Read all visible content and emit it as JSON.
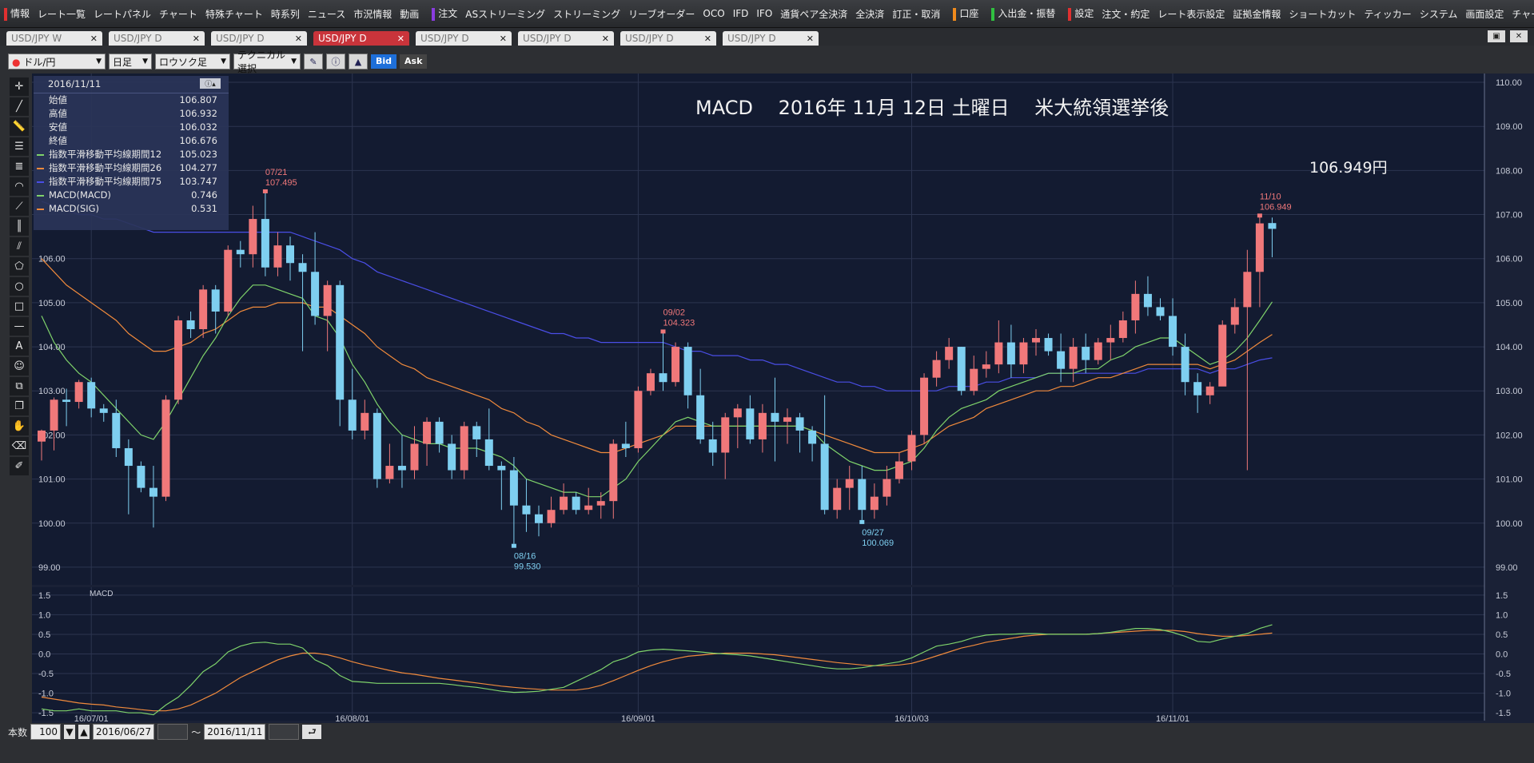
{
  "menubar": [
    "情報",
    "レート一覧",
    "レートパネル",
    "チャート",
    "特殊チャート",
    "時系列",
    "ニュース",
    "市況情報",
    "動画",
    "注文",
    "ASストリーミング",
    "ストリーミング",
    "リーブオーダー",
    "OCO",
    "IFD",
    "IFO",
    "通貨ペア全決済",
    "全決済",
    "訂正・取消",
    "口座",
    "入出金・振替",
    "設定",
    "注文・約定",
    "レート表示設定",
    "証拠金情報",
    "ショートカット",
    "ティッカー",
    "システム",
    "画面設定",
    "チャート"
  ],
  "tabs": [
    {
      "label": "USD/JPY W",
      "active": false
    },
    {
      "label": "USD/JPY D",
      "active": false
    },
    {
      "label": "USD/JPY D",
      "active": false
    },
    {
      "label": "USD/JPY D",
      "active": true
    },
    {
      "label": "USD/JPY D",
      "active": false
    },
    {
      "label": "USD/JPY D",
      "active": false
    },
    {
      "label": "USD/JPY D",
      "active": false
    },
    {
      "label": "USD/JPY D",
      "active": false
    }
  ],
  "toolbar": {
    "pair": "ドル/円",
    "period": "日足",
    "chart_type": "ロウソク足",
    "tech": "テクニカル選択",
    "bid": "Bid",
    "ask": "Ask"
  },
  "info": {
    "date": "2016/11/11",
    "rows": [
      {
        "label": "始値",
        "value": "106.807",
        "color": ""
      },
      {
        "label": "高値",
        "value": "106.932",
        "color": ""
      },
      {
        "label": "安値",
        "value": "106.032",
        "color": ""
      },
      {
        "label": "終値",
        "value": "106.676",
        "color": ""
      },
      {
        "label": "指数平滑移動平均線期間12",
        "value": "105.023",
        "color": "#7fd36b"
      },
      {
        "label": "指数平滑移動平均線期間26",
        "value": "104.277",
        "color": "#f08a3c"
      },
      {
        "label": "指数平滑移動平均線期間75",
        "value": "103.747",
        "color": "#4a4ee6"
      },
      {
        "label": "MACD(MACD)",
        "value": "0.746",
        "color": "#7fd36b"
      },
      {
        "label": "MACD(SIG)",
        "value": "0.531",
        "color": "#f08a3c"
      }
    ]
  },
  "footer": {
    "count_label": "本数",
    "count": "100",
    "from": "2016/06/27",
    "tilde": "〜",
    "to": "2016/11/11"
  },
  "chart_data": {
    "type": "candlestick",
    "title": "MACD　 2016年 11月 12日 土曜日　 米大統領選挙後",
    "price_label": "106.949円",
    "colors": {
      "up": "#f0787a",
      "down": "#7ecff0",
      "ema12": "#7fd36b",
      "ema26": "#f08a3c",
      "ema75": "#4a4ee6",
      "macd": "#7fd36b",
      "signal": "#f08a3c",
      "bg": "#131b31",
      "grid": "#2c3550"
    },
    "ylim": [
      98.6,
      110.2
    ],
    "yticks": [
      "110.00",
      "109.00",
      "108.00",
      "107.00",
      "106.00",
      "105.00",
      "104.00",
      "103.00",
      "102.00",
      "101.00",
      "100.00",
      "99.00"
    ],
    "macd_ylim": [
      -1.7,
      1.7
    ],
    "macd_label": "MACD",
    "macd_yticks": [
      "1.5",
      "1.0",
      "0.5",
      "0.0",
      "-0.5",
      "-1.0",
      "-1.5"
    ],
    "xticks": [
      {
        "label": "16/07/01",
        "i": 4
      },
      {
        "label": "16/08/01",
        "i": 25
      },
      {
        "label": "16/09/01",
        "i": 48
      },
      {
        "label": "16/10/03",
        "i": 70
      },
      {
        "label": "16/11/01",
        "i": 91
      }
    ],
    "annotations": [
      {
        "i": 18,
        "date": "07/21",
        "price": "107.495",
        "kind": "high"
      },
      {
        "i": 50,
        "date": "09/02",
        "price": "104.323",
        "kind": "high"
      },
      {
        "i": 38,
        "date": "08/16",
        "price": "99.530",
        "kind": "low"
      },
      {
        "i": 66,
        "date": "09/27",
        "price": "100.069",
        "kind": "low"
      },
      {
        "i": 98,
        "date": "11/10",
        "price": "106.949",
        "kind": "high"
      }
    ],
    "ohlc": [
      [
        101.85,
        102.12,
        101.42,
        102.1
      ],
      [
        102.1,
        102.85,
        101.65,
        102.8
      ],
      [
        102.8,
        103.05,
        102.2,
        102.75
      ],
      [
        102.75,
        103.25,
        102.6,
        103.2
      ],
      [
        103.2,
        103.3,
        102.4,
        102.6
      ],
      [
        102.6,
        102.7,
        102.3,
        102.5
      ],
      [
        102.5,
        102.8,
        101.5,
        101.7
      ],
      [
        101.7,
        101.9,
        100.2,
        101.3
      ],
      [
        101.3,
        101.4,
        100.7,
        100.8
      ],
      [
        100.8,
        101.3,
        99.9,
        100.6
      ],
      [
        100.6,
        102.9,
        100.5,
        102.8
      ],
      [
        102.8,
        104.7,
        102.7,
        104.6
      ],
      [
        104.6,
        104.8,
        104.2,
        104.4
      ],
      [
        104.4,
        105.4,
        104.2,
        105.3
      ],
      [
        105.3,
        105.4,
        104.3,
        104.8
      ],
      [
        104.8,
        106.3,
        104.7,
        106.2
      ],
      [
        106.2,
        106.4,
        105.8,
        106.1
      ],
      [
        106.1,
        107.2,
        105.8,
        106.9
      ],
      [
        106.9,
        107.5,
        105.6,
        105.8
      ],
      [
        105.8,
        106.6,
        105.6,
        106.3
      ],
      [
        106.3,
        106.5,
        105.5,
        105.9
      ],
      [
        105.9,
        106.1,
        103.9,
        105.7
      ],
      [
        105.7,
        106.6,
        104.5,
        104.7
      ],
      [
        104.7,
        105.5,
        103.9,
        105.4
      ],
      [
        105.4,
        105.5,
        102.2,
        102.8
      ],
      [
        102.8,
        103.5,
        101.9,
        102.1
      ],
      [
        102.1,
        102.8,
        101.9,
        102.5
      ],
      [
        102.5,
        102.6,
        100.8,
        101.0
      ],
      [
        101.0,
        101.8,
        100.9,
        101.3
      ],
      [
        101.3,
        102.0,
        100.8,
        101.2
      ],
      [
        101.2,
        102.2,
        101.0,
        101.8
      ],
      [
        101.8,
        102.4,
        101.3,
        102.3
      ],
      [
        102.3,
        102.4,
        101.6,
        101.8
      ],
      [
        101.8,
        102.0,
        101.0,
        101.2
      ],
      [
        101.2,
        102.3,
        101.0,
        102.2
      ],
      [
        102.2,
        102.3,
        101.5,
        101.9
      ],
      [
        101.9,
        102.6,
        101.2,
        101.3
      ],
      [
        101.3,
        101.4,
        100.3,
        101.2
      ],
      [
        101.2,
        101.5,
        99.53,
        100.4
      ],
      [
        100.4,
        101.0,
        99.8,
        100.2
      ],
      [
        100.2,
        100.4,
        99.7,
        100.0
      ],
      [
        100.0,
        100.6,
        99.9,
        100.3
      ],
      [
        100.3,
        100.9,
        100.2,
        100.6
      ],
      [
        100.6,
        100.7,
        100.2,
        100.3
      ],
      [
        100.3,
        100.8,
        100.2,
        100.4
      ],
      [
        100.4,
        100.7,
        100.1,
        100.5
      ],
      [
        100.5,
        101.9,
        100.1,
        101.8
      ],
      [
        101.8,
        102.3,
        101.5,
        101.7
      ],
      [
        101.7,
        103.1,
        101.6,
        103.0
      ],
      [
        103.0,
        103.5,
        102.9,
        103.4
      ],
      [
        103.4,
        104.32,
        103.0,
        103.2
      ],
      [
        103.2,
        104.1,
        103.1,
        104.0
      ],
      [
        104.0,
        104.1,
        102.6,
        102.9
      ],
      [
        102.9,
        103.5,
        101.8,
        101.9
      ],
      [
        101.9,
        102.3,
        101.3,
        101.6
      ],
      [
        101.6,
        102.5,
        101.0,
        102.4
      ],
      [
        102.4,
        102.7,
        101.7,
        102.6
      ],
      [
        102.6,
        102.9,
        101.8,
        101.9
      ],
      [
        101.9,
        102.7,
        101.6,
        102.5
      ],
      [
        102.5,
        103.3,
        101.4,
        102.3
      ],
      [
        102.3,
        102.6,
        101.8,
        102.4
      ],
      [
        102.4,
        102.5,
        101.6,
        102.1
      ],
      [
        102.1,
        102.2,
        101.4,
        101.8
      ],
      [
        101.8,
        102.9,
        100.2,
        100.3
      ],
      [
        100.3,
        101.0,
        100.1,
        100.8
      ],
      [
        100.8,
        101.3,
        100.3,
        101.0
      ],
      [
        101.0,
        101.3,
        100.07,
        100.3
      ],
      [
        100.3,
        100.9,
        100.1,
        100.6
      ],
      [
        100.6,
        101.3,
        100.4,
        101.0
      ],
      [
        101.0,
        101.6,
        100.9,
        101.4
      ],
      [
        101.4,
        102.1,
        101.2,
        102.0
      ],
      [
        102.0,
        103.4,
        101.8,
        103.3
      ],
      [
        103.3,
        103.9,
        103.1,
        103.7
      ],
      [
        103.7,
        104.2,
        103.5,
        104.0
      ],
      [
        104.0,
        104.0,
        102.9,
        103.0
      ],
      [
        103.0,
        103.8,
        102.9,
        103.5
      ],
      [
        103.5,
        103.9,
        103.3,
        103.6
      ],
      [
        103.6,
        104.6,
        103.4,
        104.1
      ],
      [
        104.1,
        104.5,
        103.3,
        103.6
      ],
      [
        103.6,
        104.2,
        103.4,
        104.1
      ],
      [
        104.1,
        104.4,
        103.8,
        104.2
      ],
      [
        104.2,
        104.3,
        103.8,
        103.9
      ],
      [
        103.9,
        104.3,
        103.2,
        103.5
      ],
      [
        103.5,
        104.2,
        103.2,
        104.0
      ],
      [
        104.0,
        104.3,
        103.4,
        103.7
      ],
      [
        103.7,
        104.2,
        103.6,
        104.1
      ],
      [
        104.1,
        104.5,
        103.7,
        104.2
      ],
      [
        104.2,
        104.8,
        104.1,
        104.6
      ],
      [
        104.6,
        105.5,
        104.3,
        105.2
      ],
      [
        105.2,
        105.6,
        104.7,
        104.9
      ],
      [
        104.9,
        105.1,
        104.6,
        104.7
      ],
      [
        104.7,
        105.1,
        103.8,
        104.0
      ],
      [
        104.0,
        104.3,
        102.9,
        103.2
      ],
      [
        103.2,
        103.4,
        102.5,
        102.9
      ],
      [
        102.9,
        103.2,
        102.7,
        103.1
      ],
      [
        103.1,
        104.6,
        103.2,
        104.5
      ],
      [
        104.5,
        105.1,
        104.3,
        104.9
      ],
      [
        104.9,
        106.2,
        101.2,
        105.7
      ],
      [
        105.7,
        106.95,
        104.9,
        106.8
      ],
      [
        106.807,
        106.932,
        106.032,
        106.676
      ]
    ],
    "ema12": [
      104.7,
      104.1,
      103.7,
      103.4,
      103.2,
      102.9,
      102.6,
      102.3,
      102.0,
      101.9,
      102.3,
      102.8,
      103.3,
      103.8,
      104.2,
      104.7,
      105.1,
      105.4,
      105.4,
      105.3,
      105.2,
      105.1,
      104.7,
      104.6,
      104.2,
      103.6,
      103.2,
      102.7,
      102.3,
      102.0,
      101.9,
      101.8,
      101.8,
      101.7,
      101.7,
      101.7,
      101.6,
      101.5,
      101.3,
      101.0,
      100.9,
      100.8,
      100.7,
      100.7,
      100.6,
      100.6,
      100.8,
      101.0,
      101.4,
      101.7,
      102.0,
      102.3,
      102.4,
      102.3,
      102.2,
      102.2,
      102.2,
      102.2,
      102.2,
      102.2,
      102.2,
      102.2,
      102.1,
      101.8,
      101.6,
      101.4,
      101.3,
      101.2,
      101.2,
      101.3,
      101.4,
      101.7,
      102.1,
      102.4,
      102.6,
      102.7,
      102.8,
      103.0,
      103.1,
      103.2,
      103.3,
      103.4,
      103.4,
      103.4,
      103.5,
      103.5,
      103.7,
      103.8,
      104.0,
      104.1,
      104.2,
      104.2,
      104.0,
      103.8,
      103.6,
      103.7,
      103.9,
      104.2,
      104.6,
      105.02
    ],
    "ema26": [
      106.0,
      105.7,
      105.4,
      105.2,
      105.0,
      104.8,
      104.6,
      104.3,
      104.1,
      103.9,
      103.9,
      104.0,
      104.1,
      104.3,
      104.4,
      104.6,
      104.8,
      104.9,
      104.9,
      105.0,
      105.0,
      105.0,
      104.9,
      104.9,
      104.7,
      104.5,
      104.3,
      104.0,
      103.8,
      103.6,
      103.5,
      103.3,
      103.2,
      103.1,
      103.0,
      102.9,
      102.8,
      102.6,
      102.5,
      102.3,
      102.2,
      102.0,
      101.9,
      101.8,
      101.7,
      101.6,
      101.6,
      101.7,
      101.8,
      101.9,
      102.0,
      102.2,
      102.2,
      102.2,
      102.2,
      102.2,
      102.2,
      102.2,
      102.2,
      102.2,
      102.2,
      102.2,
      102.1,
      102.0,
      101.9,
      101.8,
      101.7,
      101.6,
      101.6,
      101.6,
      101.7,
      101.8,
      102.0,
      102.2,
      102.3,
      102.4,
      102.6,
      102.7,
      102.8,
      102.9,
      103.0,
      103.0,
      103.1,
      103.1,
      103.2,
      103.3,
      103.3,
      103.4,
      103.5,
      103.6,
      103.6,
      103.6,
      103.6,
      103.6,
      103.5,
      103.6,
      103.7,
      103.9,
      104.1,
      104.28
    ],
    "ema75": [
      107.3,
      107.2,
      107.1,
      107.0,
      107.0,
      106.9,
      106.9,
      106.8,
      106.7,
      106.6,
      106.6,
      106.6,
      106.6,
      106.6,
      106.6,
      106.6,
      106.6,
      106.6,
      106.6,
      106.6,
      106.6,
      106.5,
      106.4,
      106.3,
      106.2,
      106.0,
      105.9,
      105.7,
      105.6,
      105.5,
      105.4,
      105.3,
      105.2,
      105.1,
      105.0,
      104.9,
      104.8,
      104.7,
      104.6,
      104.5,
      104.4,
      104.3,
      104.3,
      104.2,
      104.2,
      104.1,
      104.1,
      104.1,
      104.1,
      104.1,
      104.1,
      104.0,
      103.9,
      103.9,
      103.8,
      103.8,
      103.8,
      103.7,
      103.7,
      103.6,
      103.6,
      103.5,
      103.4,
      103.3,
      103.2,
      103.2,
      103.1,
      103.1,
      103.0,
      103.0,
      103.0,
      103.0,
      103.0,
      103.1,
      103.1,
      103.1,
      103.2,
      103.2,
      103.3,
      103.3,
      103.3,
      103.4,
      103.4,
      103.4,
      103.4,
      103.4,
      103.4,
      103.4,
      103.4,
      103.5,
      103.5,
      103.5,
      103.5,
      103.5,
      103.4,
      103.5,
      103.5,
      103.6,
      103.7,
      103.75
    ],
    "macd": [
      -1.4,
      -1.45,
      -1.45,
      -1.4,
      -1.45,
      -1.45,
      -1.45,
      -1.5,
      -1.5,
      -1.55,
      -1.3,
      -1.1,
      -0.8,
      -0.45,
      -0.25,
      0.05,
      0.2,
      0.28,
      0.3,
      0.25,
      0.25,
      0.15,
      -0.15,
      -0.3,
      -0.55,
      -0.7,
      -0.72,
      -0.75,
      -0.75,
      -0.75,
      -0.75,
      -0.75,
      -0.75,
      -0.78,
      -0.82,
      -0.85,
      -0.9,
      -0.95,
      -0.98,
      -0.97,
      -0.95,
      -0.9,
      -0.85,
      -0.7,
      -0.55,
      -0.4,
      -0.2,
      -0.1,
      0.05,
      0.1,
      0.12,
      0.1,
      0.08,
      0.05,
      0.02,
      0.0,
      -0.02,
      -0.05,
      -0.1,
      -0.15,
      -0.2,
      -0.25,
      -0.3,
      -0.35,
      -0.38,
      -0.38,
      -0.35,
      -0.3,
      -0.25,
      -0.2,
      -0.1,
      0.05,
      0.2,
      0.25,
      0.32,
      0.42,
      0.48,
      0.5,
      0.5,
      0.52,
      0.52,
      0.5,
      0.5,
      0.5,
      0.5,
      0.52,
      0.55,
      0.6,
      0.65,
      0.65,
      0.62,
      0.55,
      0.45,
      0.32,
      0.3,
      0.38,
      0.45,
      0.52,
      0.65,
      0.746
    ],
    "signal": [
      -1.1,
      -1.15,
      -1.2,
      -1.25,
      -1.28,
      -1.3,
      -1.35,
      -1.38,
      -1.42,
      -1.45,
      -1.45,
      -1.4,
      -1.3,
      -1.15,
      -1.0,
      -0.8,
      -0.6,
      -0.45,
      -0.3,
      -0.15,
      -0.05,
      0.02,
      0.02,
      -0.02,
      -0.1,
      -0.2,
      -0.28,
      -0.35,
      -0.42,
      -0.48,
      -0.52,
      -0.57,
      -0.62,
      -0.66,
      -0.7,
      -0.74,
      -0.78,
      -0.82,
      -0.85,
      -0.88,
      -0.9,
      -0.92,
      -0.92,
      -0.92,
      -0.88,
      -0.8,
      -0.68,
      -0.55,
      -0.42,
      -0.3,
      -0.2,
      -0.12,
      -0.06,
      -0.03,
      0.0,
      0.02,
      0.02,
      0.02,
      0.0,
      -0.02,
      -0.06,
      -0.1,
      -0.14,
      -0.18,
      -0.22,
      -0.25,
      -0.28,
      -0.3,
      -0.3,
      -0.28,
      -0.24,
      -0.15,
      -0.05,
      0.05,
      0.15,
      0.22,
      0.3,
      0.35,
      0.4,
      0.45,
      0.48,
      0.5,
      0.5,
      0.5,
      0.5,
      0.52,
      0.54,
      0.56,
      0.58,
      0.6,
      0.6,
      0.6,
      0.57,
      0.52,
      0.48,
      0.45,
      0.45,
      0.47,
      0.5,
      0.531
    ]
  }
}
